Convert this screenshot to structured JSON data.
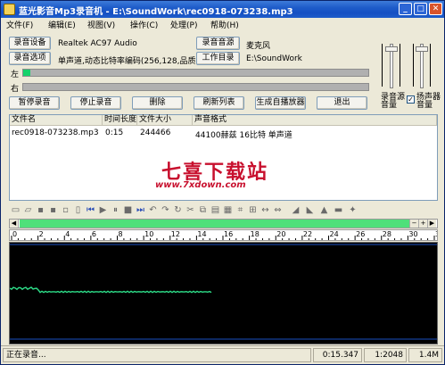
{
  "window": {
    "title": "蓝光影音Mp3录音机 - E:\\SoundWork\\rec0918-073238.mp3"
  },
  "menu": [
    "文件(F)",
    "编辑(E)",
    "视图(V)",
    "操作(C)",
    "处理(P)",
    "帮助(H)"
  ],
  "device": {
    "record_device_btn": "录音设备",
    "record_device_value": "Realtek AC97 Audio",
    "record_source_btn": "录音音源",
    "record_source_value": "麦克风",
    "record_options_btn": "录音选项",
    "record_options_value": "单声道,动态比特率编码(256,128,品质5)",
    "work_dir_btn": "工作目录",
    "work_dir_value": "E:\\SoundWork"
  },
  "meters": {
    "left_label": "左",
    "right_label": "右",
    "left_level": 0.02,
    "right_level": 0.0
  },
  "volume": {
    "source_label": "录音源\n音量",
    "speaker_label": "扬声器\n音量",
    "speaker_checked": true
  },
  "actions": {
    "pause": "暂停录音",
    "stop": "停止录音",
    "delete": "删除",
    "refresh": "刷新列表",
    "gen_player": "生成自播放器",
    "exit": "退出"
  },
  "table": {
    "headers": [
      "文件名",
      "时间长度",
      "文件大小",
      "声音格式"
    ],
    "rows": [
      [
        "rec0918-073238.mp3",
        "0:15",
        "244466",
        "44100赫兹 16比特 单声道"
      ]
    ]
  },
  "watermark": {
    "main": "七喜下载站",
    "url": "www.7xdown.com"
  },
  "ruler": [
    "0",
    "2",
    "4",
    "6",
    "8",
    "10",
    "12",
    "14",
    "16",
    "18",
    "20",
    "22",
    "24",
    "26",
    "28",
    "30",
    "32"
  ],
  "status": {
    "message": "正在录音...",
    "time": "0:15.347",
    "ratio": "1:2048",
    "size": "1.4M"
  },
  "colors": {
    "meter": "#15d26a",
    "wave": "#2ee08a",
    "scroll_thumb": "#4fe07a"
  }
}
